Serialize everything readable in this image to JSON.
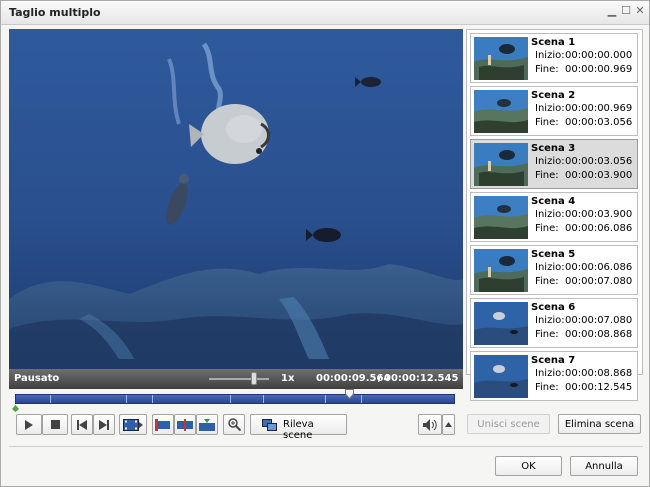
{
  "window": {
    "title": "Taglio multiplo"
  },
  "player": {
    "status": "Pausato",
    "speed": "1x",
    "current_time": "00:00:09.564",
    "separator": "/",
    "total_time": "00:00:12.545",
    "speed_level": 0.75,
    "position_fraction": 0.762,
    "scene_marks": [
      0.077,
      0.25,
      0.311,
      0.489,
      0.564,
      0.706,
      0.787
    ]
  },
  "toolbar": {
    "rileva_scene_label": "Rileva scene"
  },
  "actions": {
    "unisci_label": "Unisci scene",
    "elimina_label": "Elimina scena",
    "ok_label": "OK",
    "annulla_label": "Annulla"
  },
  "scenes": [
    {
      "title": "Scena 1",
      "inizio_label": "Inizio:",
      "inizio": "00:00:00.000",
      "fine_label": "Fine:",
      "fine": "00:00:00.969",
      "selected": false
    },
    {
      "title": "Scena 2",
      "inizio_label": "Inizio:",
      "inizio": "00:00:00.969",
      "fine_label": "Fine:",
      "fine": "00:00:03.056",
      "selected": false
    },
    {
      "title": "Scena 3",
      "inizio_label": "Inizio:",
      "inizio": "00:00:03.056",
      "fine_label": "Fine:",
      "fine": "00:00:03.900",
      "selected": true
    },
    {
      "title": "Scena 4",
      "inizio_label": "Inizio:",
      "inizio": "00:00:03.900",
      "fine_label": "Fine:",
      "fine": "00:00:06.086",
      "selected": false
    },
    {
      "title": "Scena 5",
      "inizio_label": "Inizio:",
      "inizio": "00:00:06.086",
      "fine_label": "Fine:",
      "fine": "00:00:07.080",
      "selected": false
    },
    {
      "title": "Scena 6",
      "inizio_label": "Inizio:",
      "inizio": "00:00:07.080",
      "fine_label": "Fine:",
      "fine": "00:00:08.868",
      "selected": false
    },
    {
      "title": "Scena 7",
      "inizio_label": "Inizio:",
      "inizio": "00:00:08.868",
      "fine_label": "Fine:",
      "fine": "00:00:12.545",
      "selected": false
    }
  ],
  "colors": {
    "timeline": "#2a4595",
    "selected_scene": "#dcdcdc",
    "statusbar": "#4a4a4a"
  }
}
